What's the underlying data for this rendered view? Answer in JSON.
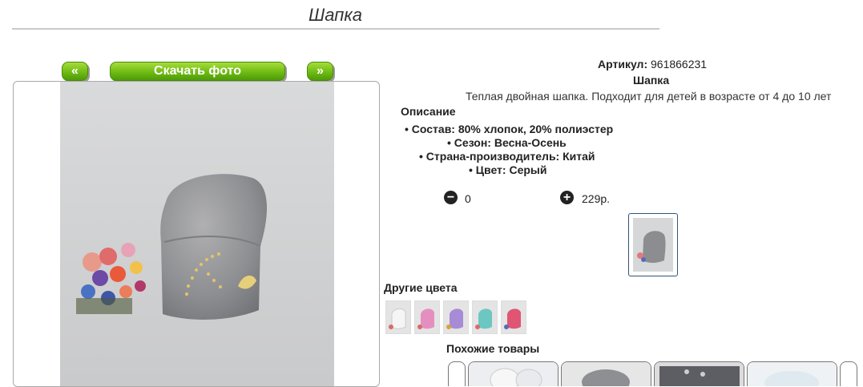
{
  "header": {
    "title": "Шапка"
  },
  "gallery": {
    "prev_label": "«",
    "download_label": "Скачать фото",
    "next_label": "»"
  },
  "product": {
    "sku_label": "Артикул:",
    "sku_value": "961866231",
    "name": "Шапка",
    "summary": "Теплая двойная шапка. Подходит для детей в возрасте от 4 до 10 лет",
    "description_heading": "Описание",
    "features": [
      "Состав: 80% хлопок, 20% полиэстер",
      "Сезон: Весна-Осень",
      "Страна-производитель: Китай",
      "Цвет: Серый"
    ],
    "quantity": "0",
    "price": "229р."
  },
  "other_colors": {
    "heading": "Другие цвета",
    "swatches": [
      "#f2f2f2",
      "#e58fc0",
      "#a88bd6",
      "#6cc7c2",
      "#e05573"
    ]
  },
  "similar": {
    "heading": "Похожие товары"
  },
  "colors": {
    "accent_green": "#6fbb14",
    "hat_gray": "#9a9a9a",
    "thumb_border": "#335577"
  }
}
